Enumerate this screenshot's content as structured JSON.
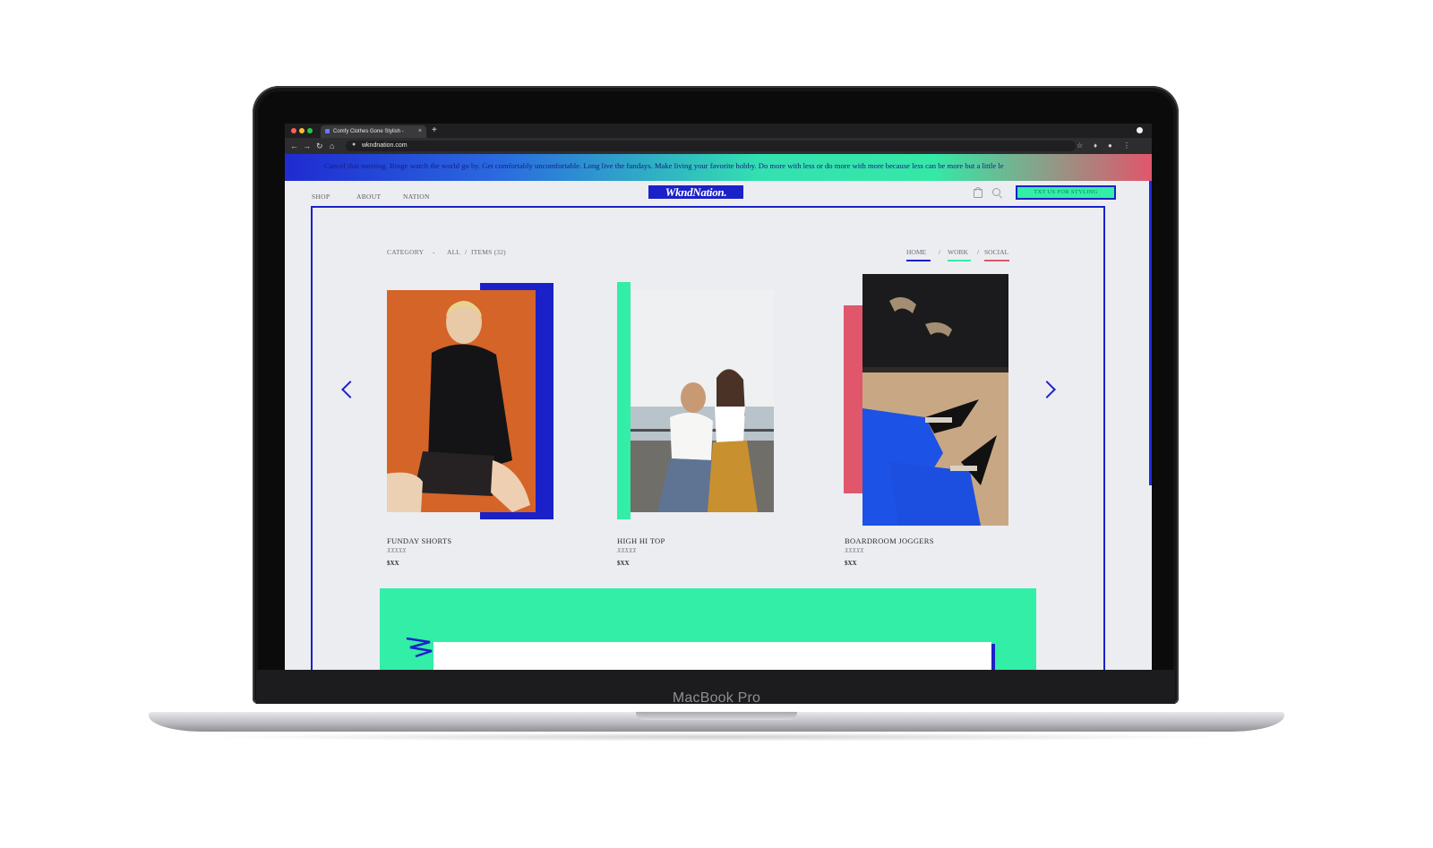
{
  "device": {
    "label": "MacBook Pro"
  },
  "browser": {
    "tab_title": "Comfy Clothes Gone Stylish -",
    "tab_close": "×",
    "new_tab": "+",
    "url": "wkndnation.com"
  },
  "page": {
    "marquee": "Cancel that meeting. Binge watch the world go by. Get comfortably uncomfortable. Long live the fundays. Make living your favorite hobby. Do more with less or do more with more because less can be more but a little le",
    "nav": [
      "SHOP",
      "ABOUT",
      "NATION"
    ],
    "logo": "WkndNation.",
    "cta_label": "TXT US FOR STYLING",
    "breadcrumb": {
      "category": "CATEGORY",
      "separator": "-",
      "all": "ALL",
      "slash": "/",
      "items": "ITEMS (32)"
    },
    "filters": [
      {
        "label": "HOME",
        "color": "#1b21c8"
      },
      {
        "label": "WORK",
        "color": "#32eea6"
      },
      {
        "label": "SOCIAL",
        "color": "#e0566b"
      }
    ],
    "filter_separator": "/",
    "products": [
      {
        "name": "FUNDAY SHORTS",
        "subtitle": "XXXXX",
        "price": "$XX",
        "accent_color": "#1b21c8"
      },
      {
        "name": "HIGH HI TOP",
        "subtitle": "XXXXX",
        "price": "$XX",
        "accent_color": "#32eea6"
      },
      {
        "name": "BOARDROOM JOGGERS",
        "subtitle": "XXXXX",
        "price": "$XX",
        "accent_color": "#e0566b"
      }
    ]
  }
}
